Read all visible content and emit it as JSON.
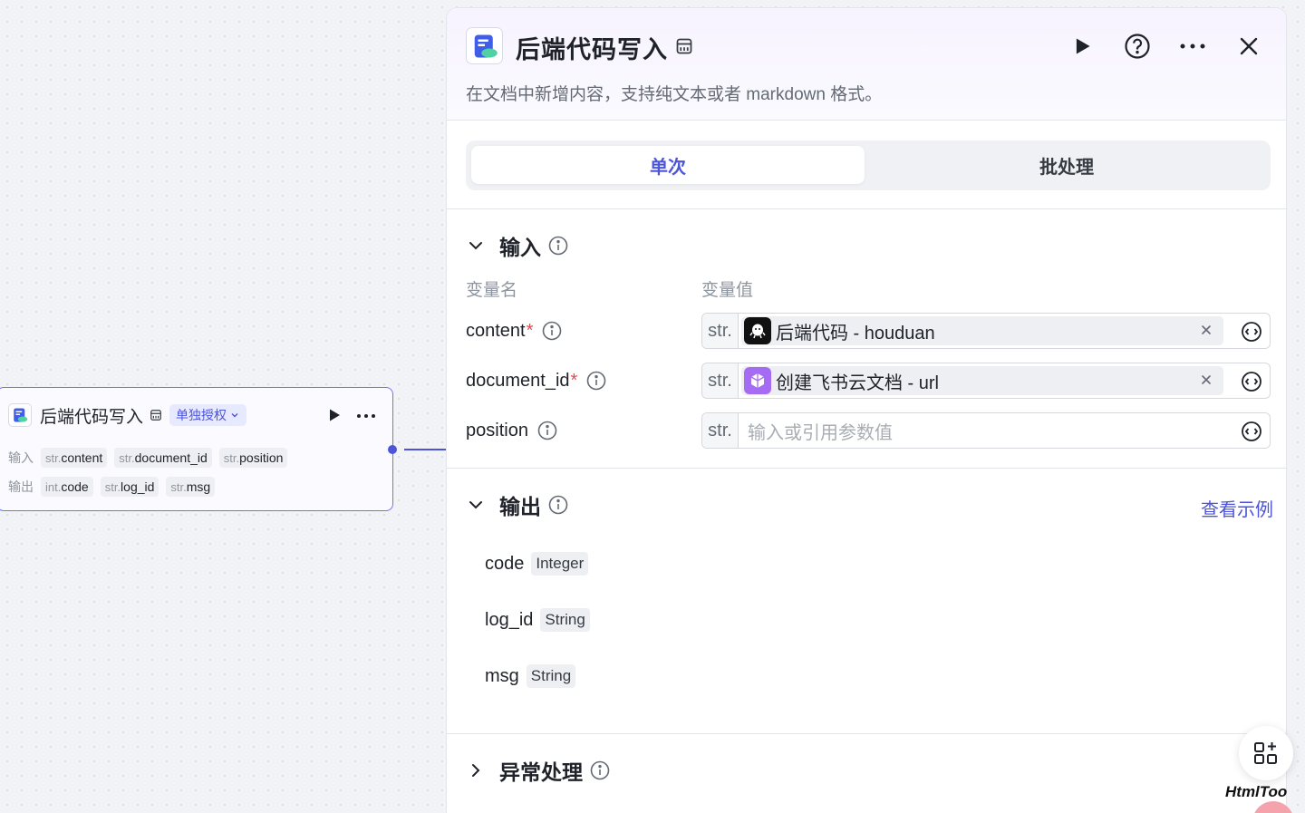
{
  "node": {
    "title": "后端代码写入",
    "auth_label": "单独授权",
    "input_label": "输入",
    "output_label": "输出",
    "inputs": [
      {
        "type": "str.",
        "name": "content"
      },
      {
        "type": "str.",
        "name": "document_id"
      },
      {
        "type": "str.",
        "name": "position"
      }
    ],
    "outputs": [
      {
        "type": "int.",
        "name": "code"
      },
      {
        "type": "str.",
        "name": "log_id"
      },
      {
        "type": "str.",
        "name": "msg"
      }
    ]
  },
  "panel": {
    "title": "后端代码写入",
    "description": "在文档中新增内容，支持纯文本或者 markdown 格式。",
    "tabs": [
      {
        "label": "单次",
        "active": true
      },
      {
        "label": "批处理",
        "active": false
      }
    ],
    "input_section": {
      "title": "输入",
      "col_name": "变量名",
      "col_value": "变量值",
      "params": [
        {
          "name": "content",
          "required": "*",
          "type": "str.",
          "ref": "后端代码 - houduan",
          "ref_icon": "code-plugin-icon"
        },
        {
          "name": "document_id",
          "required": "*",
          "type": "str.",
          "ref": "创建飞书云文档 - url",
          "ref_icon": "feishu-doc-icon"
        },
        {
          "name": "position",
          "required": "",
          "type": "str.",
          "placeholder": "输入或引用参数值"
        }
      ]
    },
    "output_section": {
      "title": "输出",
      "link": "查看示例",
      "fields": [
        {
          "name": "code",
          "type": "Integer"
        },
        {
          "name": "log_id",
          "type": "String"
        },
        {
          "name": "msg",
          "type": "String"
        }
      ]
    },
    "error_section": {
      "title": "异常处理"
    }
  },
  "watermark": "HtmlToo",
  "colors": {
    "accent": "#4c54d9",
    "required": "#e5484d",
    "muted": "#8f959e"
  }
}
